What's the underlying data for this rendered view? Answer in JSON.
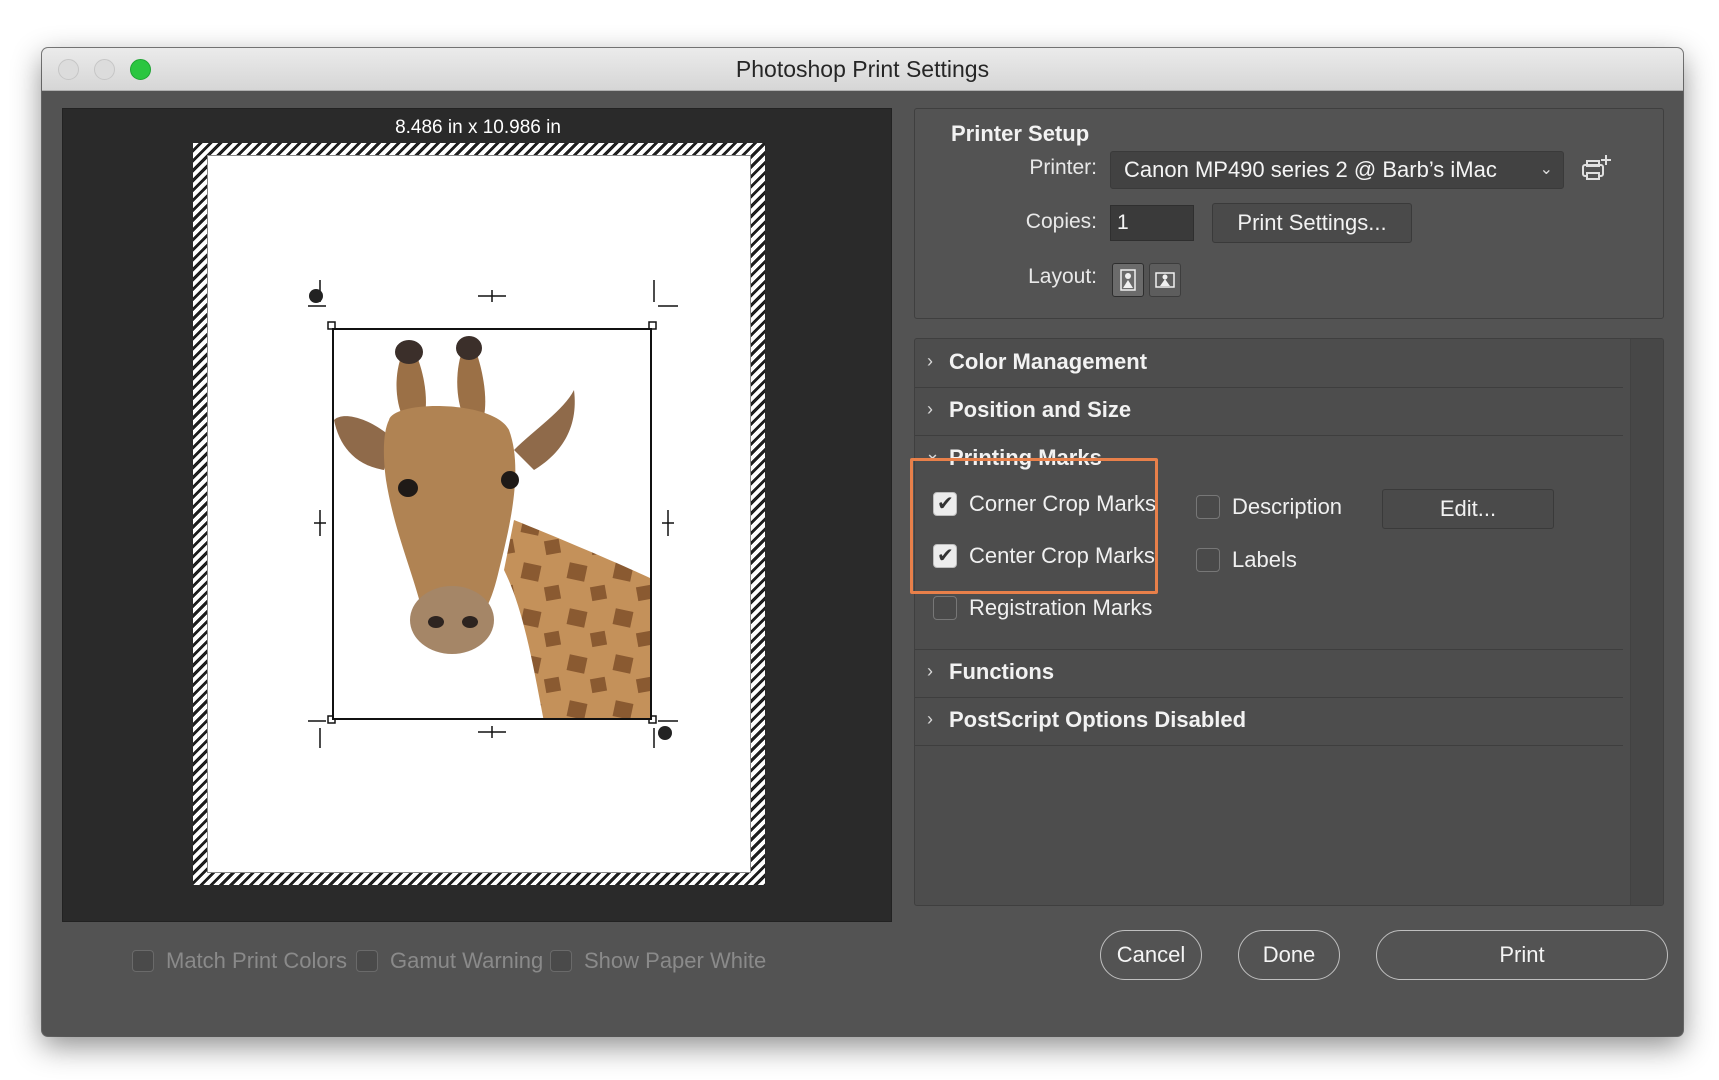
{
  "window": {
    "title": "Photoshop Print Settings"
  },
  "preview": {
    "paper_size": "8.486 in x 10.986 in",
    "options": [
      {
        "label": "Match Print Colors",
        "checked": false
      },
      {
        "label": "Gamut Warning",
        "checked": false
      },
      {
        "label": "Show Paper White",
        "checked": false
      }
    ]
  },
  "printer_setup": {
    "title": "Printer Setup",
    "printer_label": "Printer:",
    "printer_value": "Canon MP490 series 2 @ Barb’s iMac",
    "copies_label": "Copies:",
    "copies_value": "1",
    "print_settings_button": "Print Settings...",
    "layout_label": "Layout:",
    "printer_add_icon": "printer-add-icon",
    "layout_icons": [
      "portrait-layout-icon",
      "landscape-layout-icon"
    ]
  },
  "sections": {
    "color_management": "Color Management",
    "position_and_size": "Position and Size",
    "printing_marks": "Printing Marks",
    "functions": "Functions",
    "postscript": "PostScript Options Disabled"
  },
  "printing_marks": {
    "corner_crop_marks": {
      "label": "Corner Crop Marks",
      "checked": true
    },
    "center_crop_marks": {
      "label": "Center Crop Marks",
      "checked": true
    },
    "registration_marks": {
      "label": "Registration Marks",
      "checked": false
    },
    "description": {
      "label": "Description",
      "checked": false
    },
    "labels": {
      "label": "Labels",
      "checked": false
    },
    "edit_button": "Edit..."
  },
  "buttons": {
    "cancel": "Cancel",
    "done": "Done",
    "print": "Print"
  },
  "colors": {
    "highlight": "#e8804a",
    "zoom_button": "#2ac640",
    "panel_bg": "#535353"
  }
}
